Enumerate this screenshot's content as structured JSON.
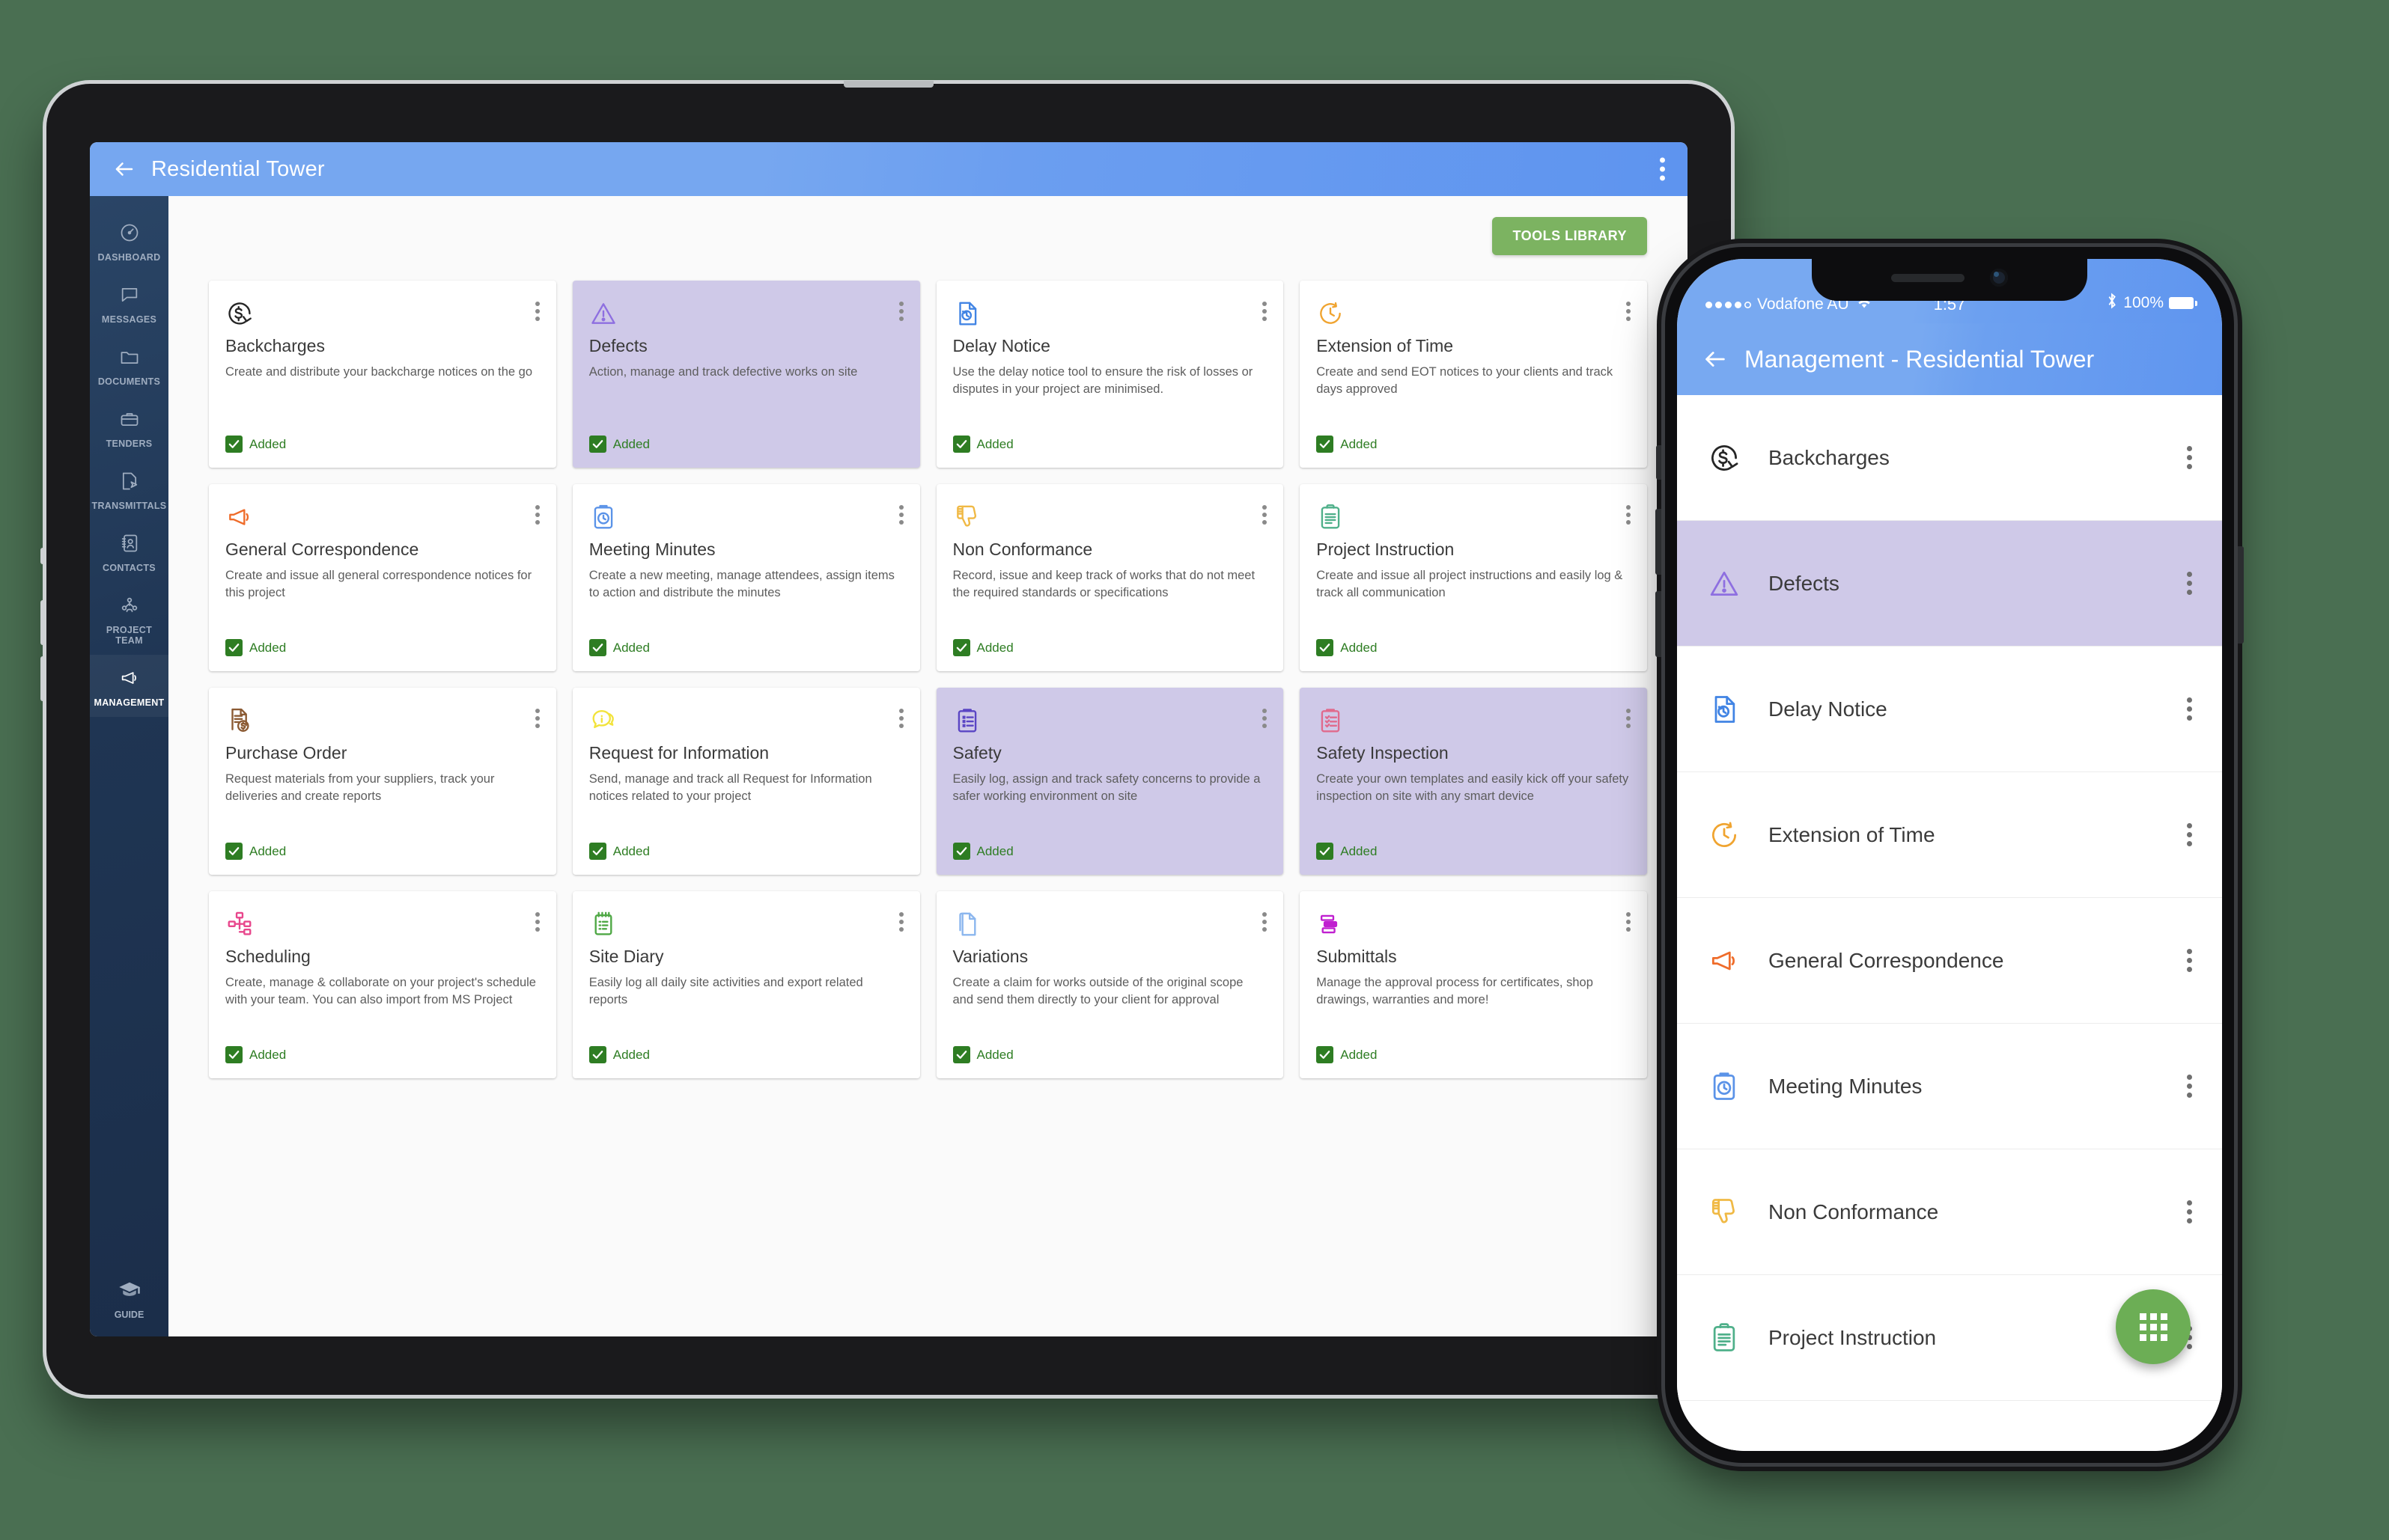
{
  "background_color": "#4a6f52",
  "tablet": {
    "appbar": {
      "title": "Residential Tower",
      "back_icon": "arrow-left-icon",
      "menu_icon": "kebab-menu-icon"
    },
    "sidebar": {
      "items": [
        {
          "label": "DASHBOARD",
          "icon": "gauge-icon",
          "active": false
        },
        {
          "label": "MESSAGES",
          "icon": "chat-bubble-icon",
          "active": false
        },
        {
          "label": "DOCUMENTS",
          "icon": "folder-icon",
          "active": false
        },
        {
          "label": "TENDERS",
          "icon": "briefcase-icon",
          "active": false
        },
        {
          "label": "TRANSMITTALS",
          "icon": "document-send-icon",
          "active": false
        },
        {
          "label": "CONTACTS",
          "icon": "address-book-icon",
          "active": false
        },
        {
          "label": "PROJECT TEAM",
          "icon": "people-group-icon",
          "active": false
        },
        {
          "label": "MANAGEMENT",
          "icon": "megaphone-icon",
          "active": true
        }
      ],
      "footer": {
        "label": "GUIDE",
        "icon": "graduation-cap-icon"
      }
    },
    "toolbar": {
      "tools_library_label": "TOOLS LIBRARY",
      "tools_library_color": "#7cb361"
    },
    "cards": [
      {
        "title": "Backcharges",
        "desc": "Create and distribute your backcharge notices on the go",
        "status": "Added",
        "icon": "dollar-refresh-icon",
        "icon_color": "#262626",
        "highlighted": false
      },
      {
        "title": "Defects",
        "desc": "Action, manage and track defective works on site",
        "status": "Added",
        "icon": "warning-triangle-icon",
        "icon_color": "#8e6fe0",
        "highlighted": true
      },
      {
        "title": "Delay Notice",
        "desc": "Use the delay notice tool to ensure the risk of losses or disputes in your project are minimised.",
        "status": "Added",
        "icon": "document-clock-icon",
        "icon_color": "#4184e4",
        "highlighted": false
      },
      {
        "title": "Extension of Time",
        "desc": "Create and send EOT notices to your clients and track days approved",
        "status": "Added",
        "icon": "clock-rewind-icon",
        "icon_color": "#f0a430",
        "highlighted": false
      },
      {
        "title": "General Correspondence",
        "desc": "Create and issue all general correspondence notices for this project",
        "status": "Added",
        "icon": "megaphone-icon",
        "icon_color": "#ef6c2a",
        "highlighted": false
      },
      {
        "title": "Meeting Minutes",
        "desc": "Create a new meeting, manage attendees, assign items to action and distribute the minutes",
        "status": "Added",
        "icon": "clipboard-clock-icon",
        "icon_color": "#5b93e8",
        "highlighted": false
      },
      {
        "title": "Non Conformance",
        "desc": "Record, issue and keep track of works that do not meet the required standards or specifications",
        "status": "Added",
        "icon": "thumbs-down-icon",
        "icon_color": "#f0b945",
        "highlighted": false
      },
      {
        "title": "Project Instruction",
        "desc": "Create and issue all project instructions and easily log & track all communication",
        "status": "Added",
        "icon": "clipboard-lines-icon",
        "icon_color": "#4fb08a",
        "highlighted": false
      },
      {
        "title": "Purchase Order",
        "desc": "Request materials from your suppliers, track your deliveries and create reports",
        "status": "Added",
        "icon": "invoice-dollar-icon",
        "icon_color": "#8b5a33",
        "highlighted": false
      },
      {
        "title": "Request for Information",
        "desc": "Send, manage and track all Request for Information notices related to your project",
        "status": "Added",
        "icon": "info-bubble-icon",
        "icon_color": "#f2e33c",
        "highlighted": false
      },
      {
        "title": "Safety",
        "desc": "Easily log, assign and track safety concerns to provide a safer working environment on site",
        "status": "Added",
        "icon": "clipboard-checklist-icon",
        "icon_color": "#5a45c4",
        "highlighted": true
      },
      {
        "title": "Safety Inspection",
        "desc": "Create your own templates and easily kick off your safety inspection on site with any smart device",
        "status": "Added",
        "icon": "clipboard-check-icon",
        "icon_color": "#e06a8d",
        "highlighted": true
      },
      {
        "title": "Scheduling",
        "desc": "Create, manage & collaborate on your project's schedule with your team. You can also import from MS Project",
        "status": "Added",
        "icon": "org-chart-icon",
        "icon_color": "#e8468c",
        "highlighted": false
      },
      {
        "title": "Site Diary",
        "desc": "Easily log all daily site activities and export related reports",
        "status": "Added",
        "icon": "notepad-icon",
        "icon_color": "#4fa845",
        "highlighted": false
      },
      {
        "title": "Variations",
        "desc": "Create a claim for works outside of the original scope and send them directly to your client for approval",
        "status": "Added",
        "icon": "document-copy-icon",
        "icon_color": "#8bb6ee",
        "highlighted": false
      },
      {
        "title": "Submittals",
        "desc": "Manage the approval process for certificates, shop drawings, warranties and more!",
        "status": "Added",
        "icon": "stacked-bars-icon",
        "icon_color": "#c020d0",
        "highlighted": false
      }
    ]
  },
  "phone": {
    "status_bar": {
      "carrier": "Vodafone AU",
      "time": "1:57",
      "battery_percent": "100%",
      "signal_icon": "signal-dots-icon",
      "wifi_icon": "wifi-icon",
      "bluetooth_icon": "bluetooth-icon",
      "battery_icon": "battery-full-icon"
    },
    "appbar": {
      "title": "Management - Residential Tower",
      "back_icon": "arrow-left-icon"
    },
    "list": [
      {
        "label": "Backcharges",
        "icon": "dollar-refresh-icon",
        "icon_color": "#262626",
        "highlighted": false
      },
      {
        "label": "Defects",
        "icon": "warning-triangle-icon",
        "icon_color": "#8e6fe0",
        "highlighted": true
      },
      {
        "label": "Delay Notice",
        "icon": "document-clock-icon",
        "icon_color": "#4184e4",
        "highlighted": false
      },
      {
        "label": "Extension of Time",
        "icon": "clock-rewind-icon",
        "icon_color": "#f0a430",
        "highlighted": false
      },
      {
        "label": "General Correspondence",
        "icon": "megaphone-icon",
        "icon_color": "#ef6c2a",
        "highlighted": false
      },
      {
        "label": "Meeting Minutes",
        "icon": "clipboard-clock-icon",
        "icon_color": "#5b93e8",
        "highlighted": false
      },
      {
        "label": "Non Conformance",
        "icon": "thumbs-down-icon",
        "icon_color": "#f0b945",
        "highlighted": false
      },
      {
        "label": "Project Instruction",
        "icon": "clipboard-lines-icon",
        "icon_color": "#4fb08a",
        "highlighted": false
      }
    ],
    "fab": {
      "icon": "grid-apps-icon",
      "color": "#6cae55"
    }
  }
}
